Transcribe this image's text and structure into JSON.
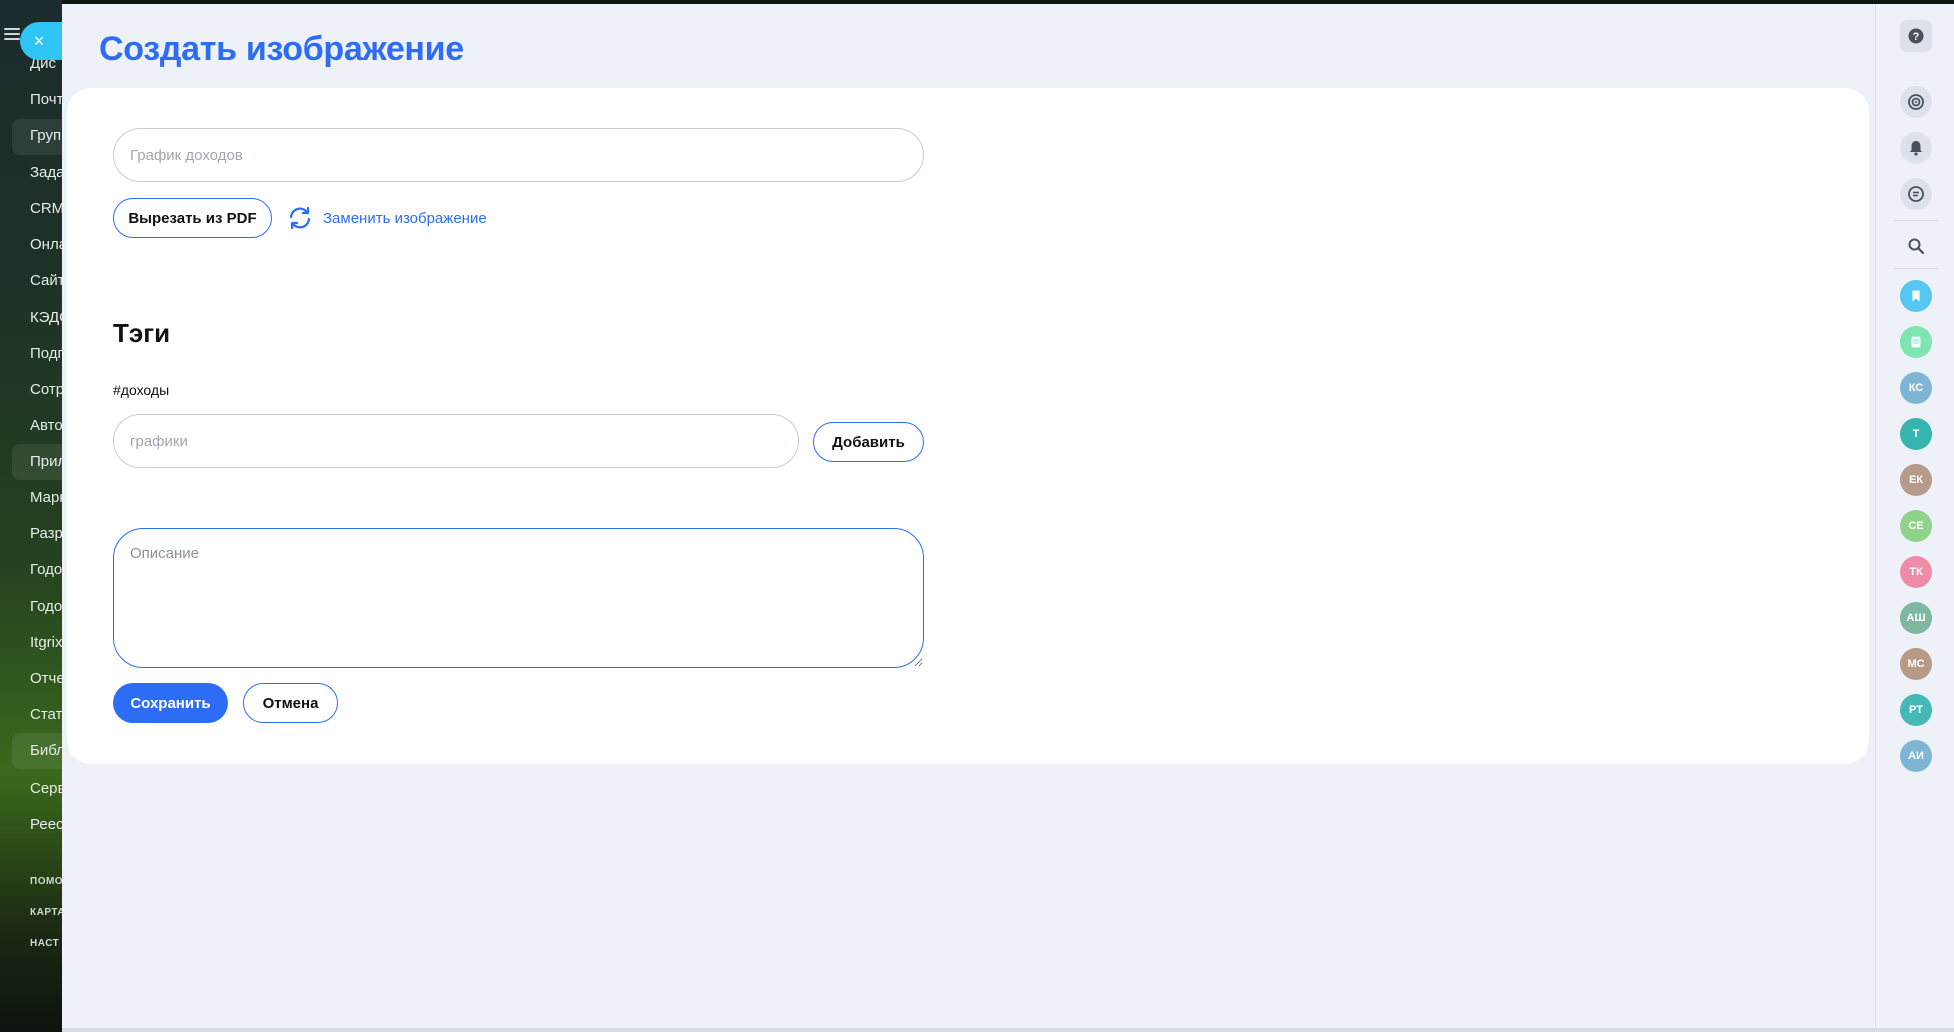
{
  "background_nav": {
    "items": [
      "Дис",
      "Почт",
      "Груп",
      "Зада",
      "CRM",
      "Онла",
      "Сайт",
      "КЭДС",
      "Подп",
      "Сотр",
      "Авто",
      "Прил",
      "Марк",
      "Разр",
      "Годо",
      "Годо",
      "Itgrix",
      "Отче",
      "Стат",
      "Библ",
      "Серв",
      "Реес"
    ],
    "footer_items": [
      "ПОМО",
      "КАРТА",
      "НАСТ"
    ]
  },
  "header": {
    "title": "Создать изображение",
    "close_label": "×"
  },
  "form": {
    "title_placeholder": "График доходов",
    "pdf_button": "Вырезать из PDF",
    "replace_link": "Заменить изображение",
    "tags_title": "Тэги",
    "tags": [
      "#доходы"
    ],
    "tag_placeholder": "графики",
    "add_button": "Добавить",
    "description_placeholder": "Описание",
    "save_button": "Сохранить",
    "cancel_button": "Отмена"
  },
  "right_rail": {
    "icons": [
      "help-icon",
      "target-icon",
      "bell-icon",
      "chat-icon",
      "search-icon",
      "bookmark-icon",
      "document-icon"
    ],
    "avatars": [
      {
        "initials": "КС",
        "color": "#7fb6d6"
      },
      {
        "initials": "Т",
        "color": "#35b5b0"
      },
      {
        "initials": "ЕК",
        "color": "#b69a8a"
      },
      {
        "initials": "СЕ",
        "color": "#8fd38a"
      },
      {
        "initials": "ТК",
        "color": "#ee8ca8"
      },
      {
        "initials": "АШ",
        "color": "#7fb8a0"
      },
      {
        "initials": "МС",
        "color": "#b79a86"
      },
      {
        "initials": "РТ",
        "color": "#45b8b8"
      },
      {
        "initials": "АИ",
        "color": "#7fb6d6"
      }
    ],
    "accent_colors": {
      "bookmark": "#57c7f2",
      "document": "#7de6b0"
    }
  },
  "colors": {
    "accent": "#2d6df6",
    "panel_bg": "#eef1f8",
    "close_button": "#2fc6f6"
  }
}
